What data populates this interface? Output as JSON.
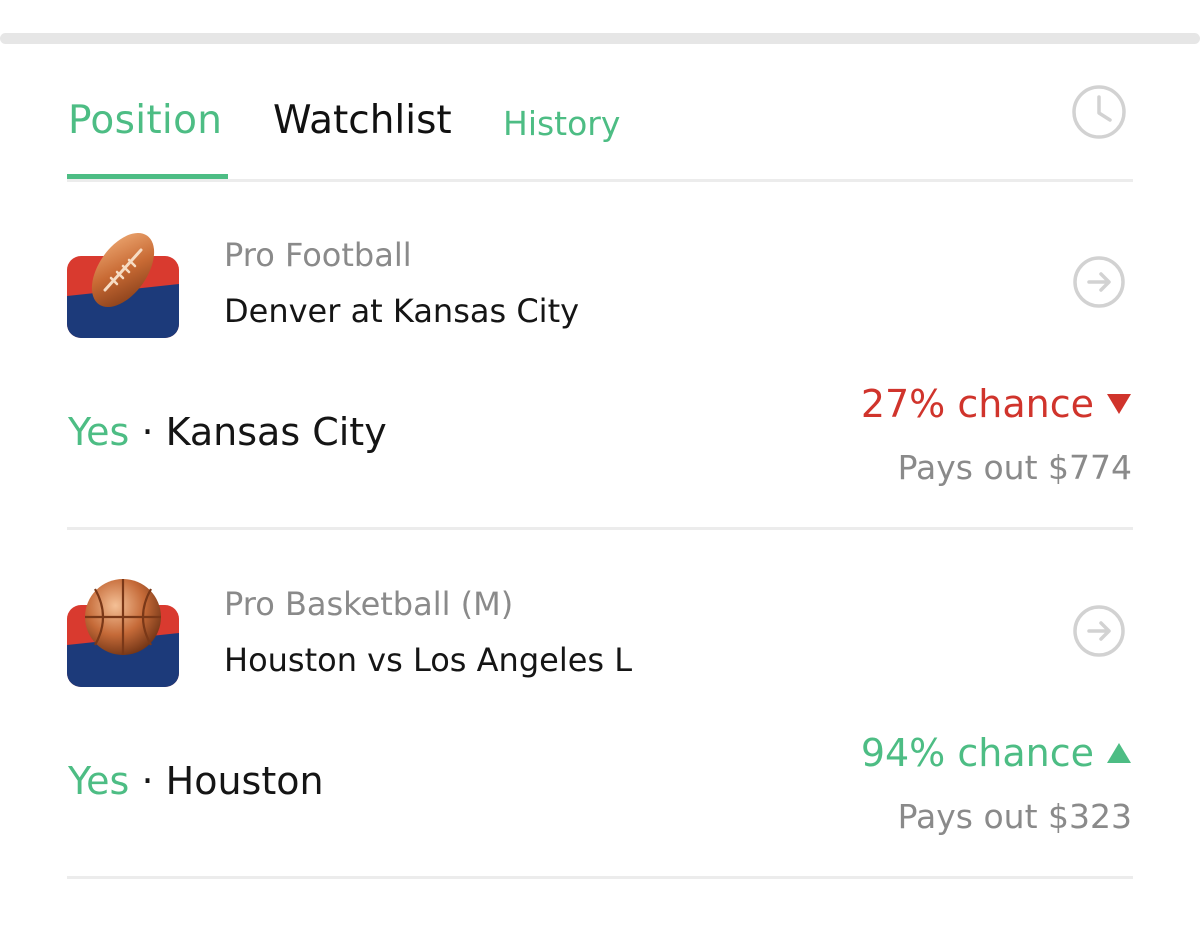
{
  "tabs": [
    {
      "label": "Position",
      "active": true
    },
    {
      "label": "Watchlist",
      "active": false
    },
    {
      "label": "History",
      "active": false
    }
  ],
  "header": {
    "history_icon": "clock-icon"
  },
  "colors": {
    "accent_green": "#4dbd84",
    "down_red": "#d0342c",
    "muted_text": "#8a8a8a",
    "primary_text": "#151515",
    "divider": "#ececec"
  },
  "positions": [
    {
      "icon": "football-icon",
      "category": "Pro Football",
      "event": "Denver at Kansas City",
      "pick_side": "Yes",
      "pick_separator": "·",
      "pick_team": "Kansas City",
      "chance": "27% chance",
      "trend": "down",
      "payout": "Pays out $774"
    },
    {
      "icon": "basketball-icon",
      "category": "Pro Basketball (M)",
      "event": "Houston vs Los Angeles L",
      "pick_side": "Yes",
      "pick_separator": "·",
      "pick_team": "Houston",
      "chance": "94% chance",
      "trend": "up",
      "payout": "Pays out $323"
    }
  ]
}
